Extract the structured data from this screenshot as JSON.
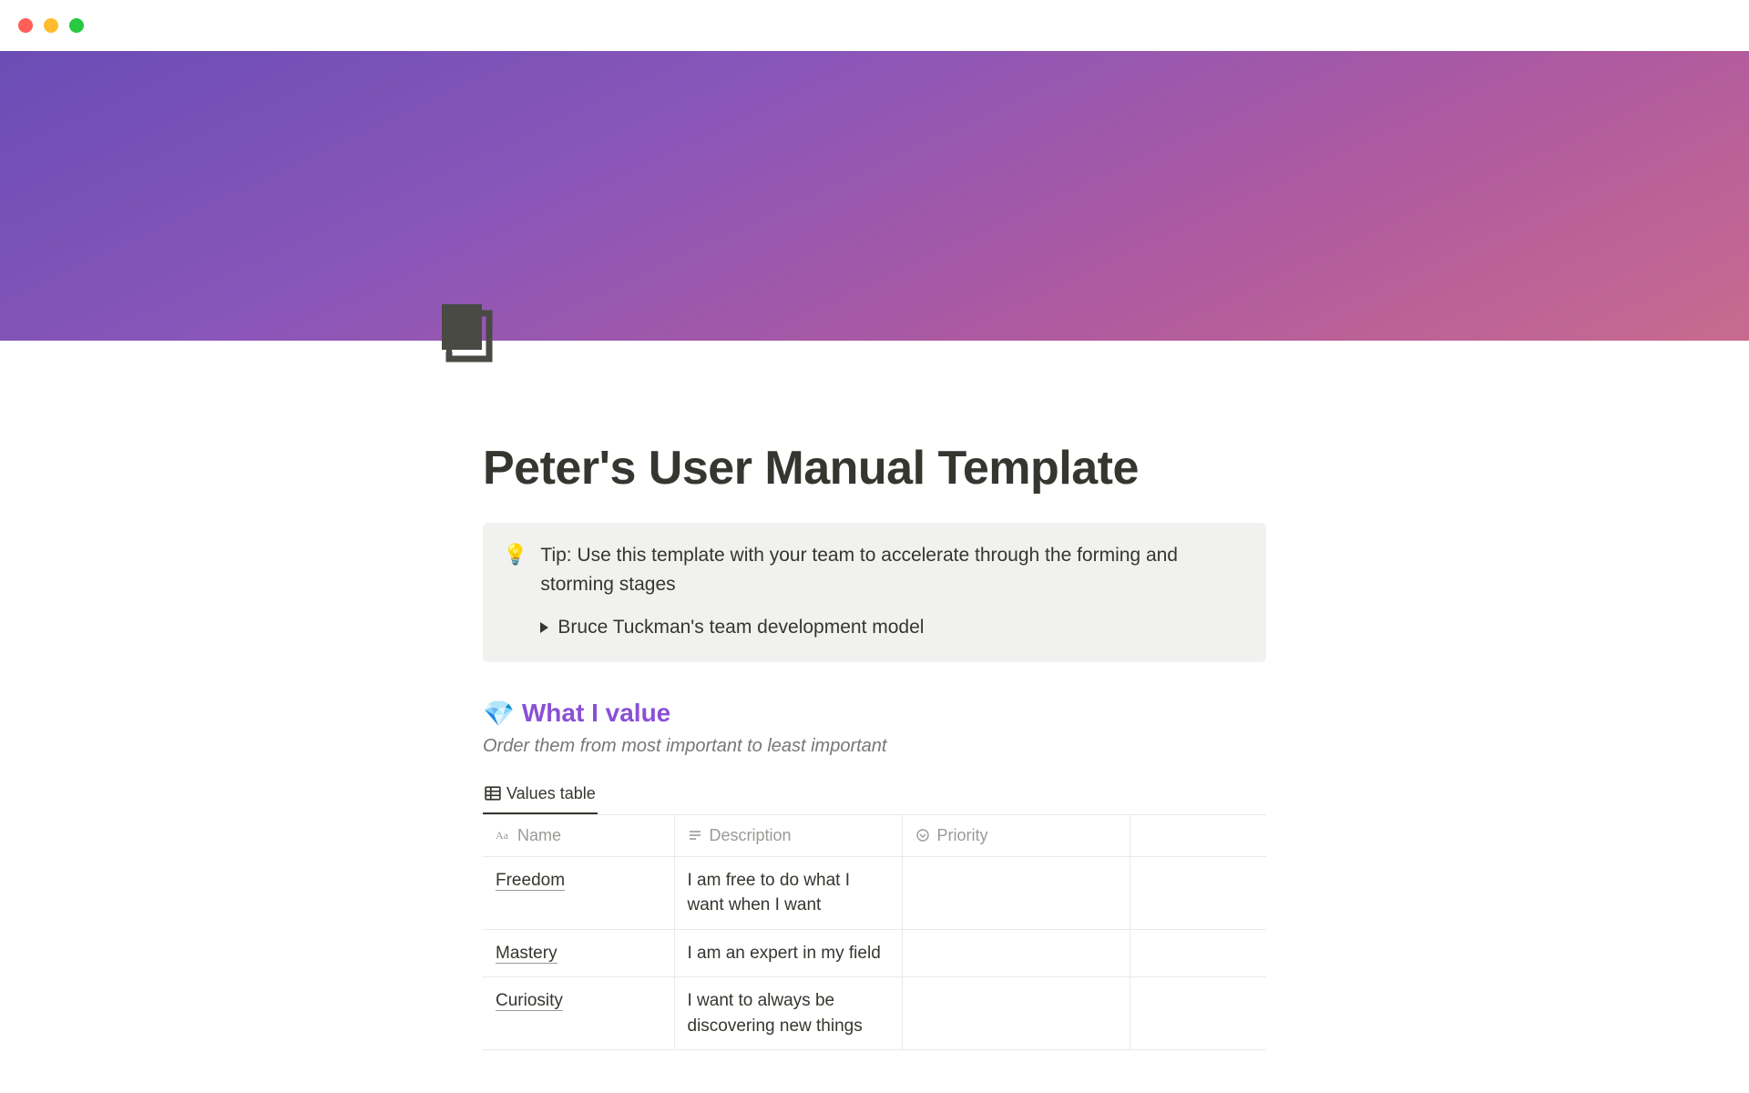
{
  "page": {
    "title": "Peter's User Manual Template"
  },
  "callout": {
    "emoji": "💡",
    "text": "Tip: Use this template with your team to accelerate through the forming and storming stages",
    "toggle_label": "Bruce Tuckman's team development model"
  },
  "section": {
    "emoji": "💎",
    "heading": "What I value",
    "subtitle": "Order them from most important to least important"
  },
  "database": {
    "tab_label": "Values table",
    "columns": {
      "name": "Name",
      "description": "Description",
      "priority": "Priority"
    },
    "rows": [
      {
        "name": "Freedom",
        "description": "I am free to do what I want when I want",
        "priority": ""
      },
      {
        "name": "Mastery",
        "description": "I am an expert in my field",
        "priority": ""
      },
      {
        "name": "Curiosity",
        "description": "I want to always be discovering new things",
        "priority": ""
      }
    ]
  }
}
